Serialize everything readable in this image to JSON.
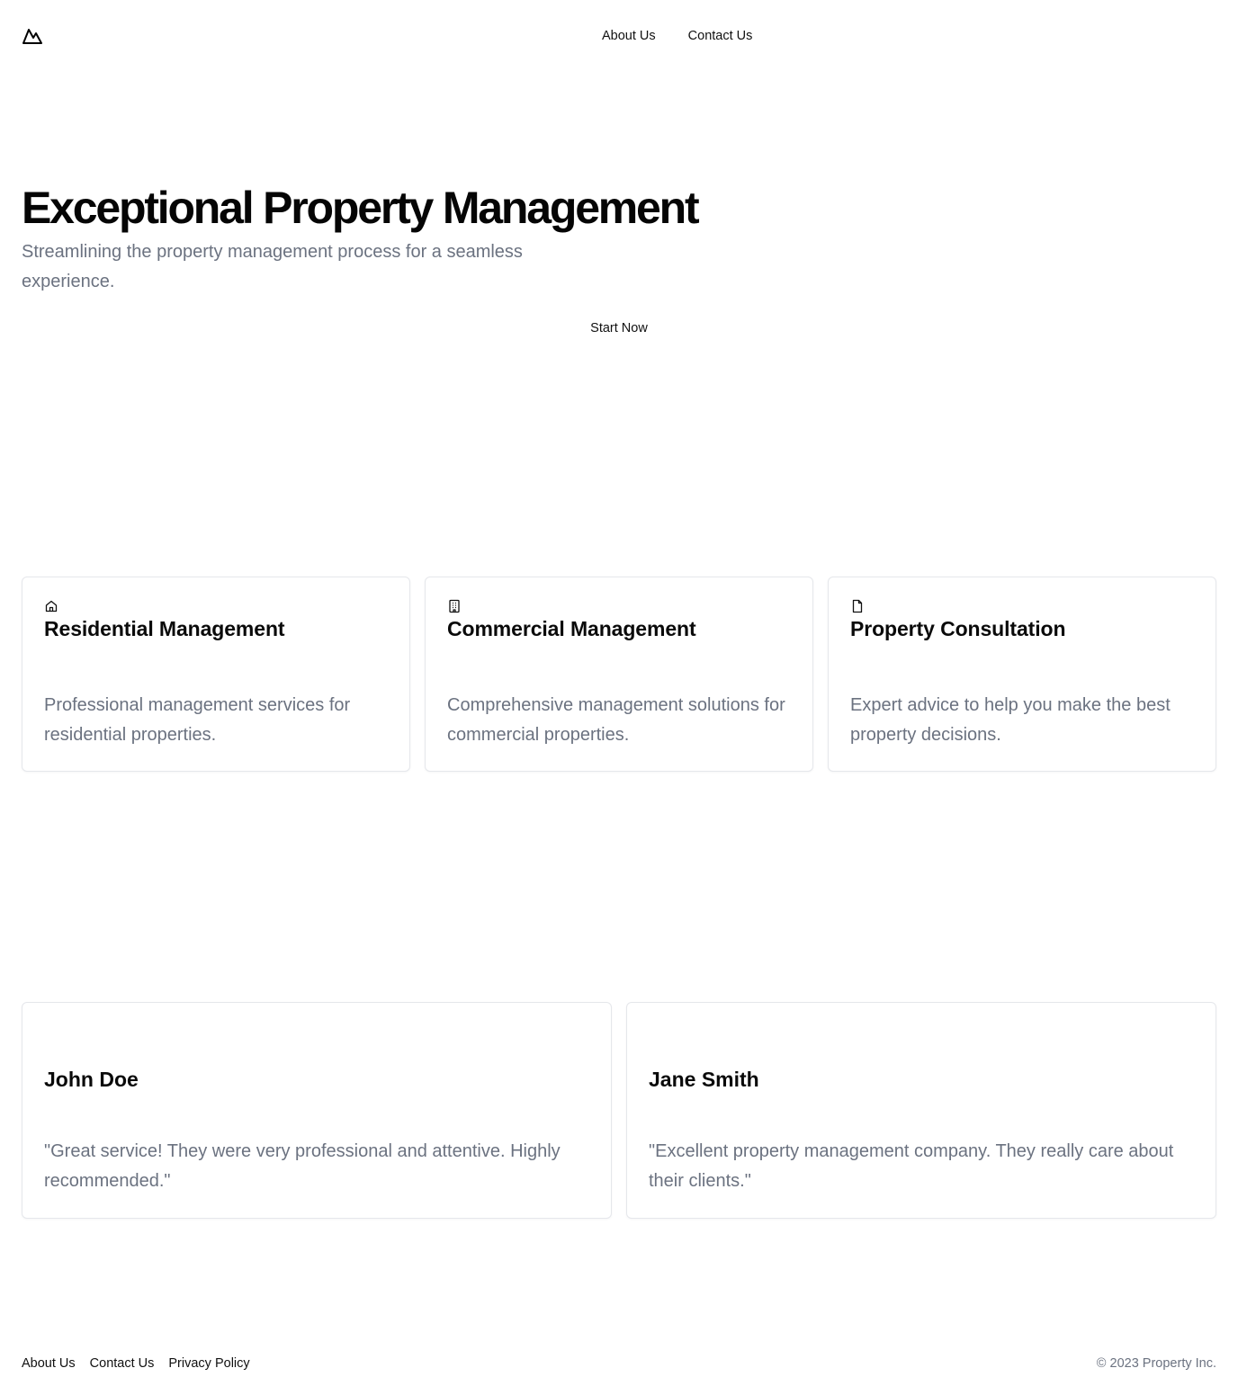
{
  "header": {
    "logo_icon": "mountain-icon",
    "nav": [
      {
        "label": "About Us"
      },
      {
        "label": "Contact Us"
      }
    ]
  },
  "hero": {
    "title": "Exceptional Property Management",
    "subtitle": "Streamlining the property management process for a seamless experience.",
    "cta_label": "Start Now"
  },
  "services": [
    {
      "icon": "home-icon",
      "title": "Residential Management",
      "description": "Professional management services for residential properties."
    },
    {
      "icon": "building-icon",
      "title": "Commercial Management",
      "description": "Comprehensive management solutions for commercial properties."
    },
    {
      "icon": "file-icon",
      "title": "Property Consultation",
      "description": "Expert advice to help you make the best property decisions."
    }
  ],
  "testimonials": [
    {
      "name": "John Doe",
      "quote": "\"Great service! They were very professional and attentive. Highly recommended.\""
    },
    {
      "name": "Jane Smith",
      "quote": "\"Excellent property management company. They really care about their clients.\""
    }
  ],
  "footer": {
    "links": [
      {
        "label": "About Us"
      },
      {
        "label": "Contact Us"
      },
      {
        "label": "Privacy Policy"
      }
    ],
    "copyright": "© 2023 Property Inc."
  },
  "colors": {
    "text": "#0a0a0a",
    "muted": "#6b7280",
    "border": "#e5e7eb",
    "background": "#ffffff"
  }
}
